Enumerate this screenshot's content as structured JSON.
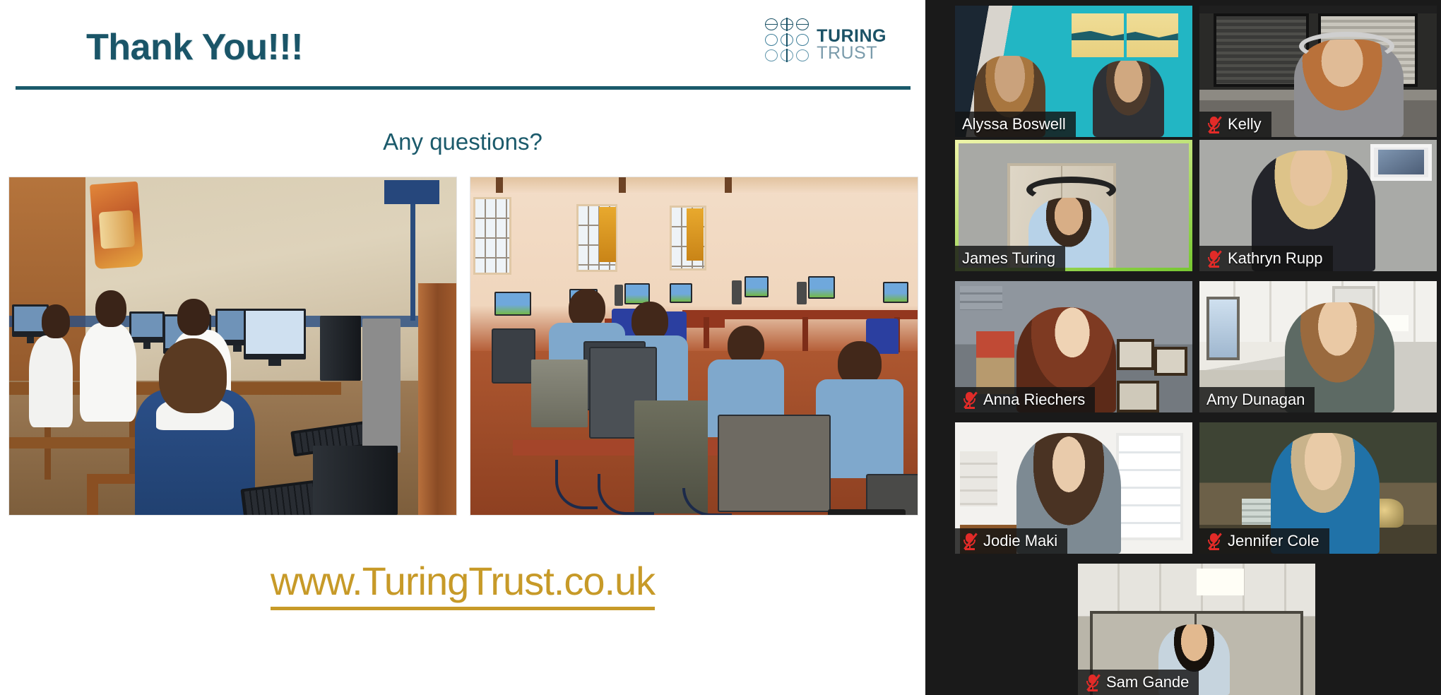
{
  "slide": {
    "title": "Thank You!!!",
    "subtitle": "Any questions?",
    "link": "www.TuringTrust.co.uk",
    "logo": {
      "word_top": "TURING",
      "word_bottom": "TRUST"
    },
    "photos": [
      {
        "alt": "Students in white school uniforms using desktop computers in a classroom"
      },
      {
        "alt": "Students in blue uniforms smiling at desktop computers in a bright computer lab"
      }
    ],
    "colors": {
      "title": "#1a5568",
      "rule": "#1b5a6b",
      "subtitle": "#1b5a6b",
      "link": "#c79a28",
      "logo_dark": "#1b5266",
      "logo_light": "#7a9bab"
    }
  },
  "meeting": {
    "active_speaker": "James Turing",
    "active_border_color": "#c9e265",
    "mute_icon_color": "#e22b28",
    "participants": [
      {
        "name": "Alyssa Boswell",
        "muted": false,
        "active": false,
        "feed": "f-alyssa"
      },
      {
        "name": "Kelly",
        "muted": true,
        "active": false,
        "feed": "f-kelly"
      },
      {
        "name": "James Turing",
        "muted": false,
        "active": true,
        "feed": "f-james"
      },
      {
        "name": "Kathryn Rupp",
        "muted": true,
        "active": false,
        "feed": "f-kathryn"
      },
      {
        "name": "Anna Riechers",
        "muted": true,
        "active": false,
        "feed": "f-anna"
      },
      {
        "name": "Amy Dunagan",
        "muted": false,
        "active": false,
        "feed": "f-amy"
      },
      {
        "name": "Jodie Maki",
        "muted": true,
        "active": false,
        "feed": "f-jodie"
      },
      {
        "name": "Jennifer Cole",
        "muted": true,
        "active": false,
        "feed": "f-jennifer"
      },
      {
        "name": "Sam Gande",
        "muted": true,
        "active": false,
        "feed": "f-sam"
      }
    ]
  }
}
